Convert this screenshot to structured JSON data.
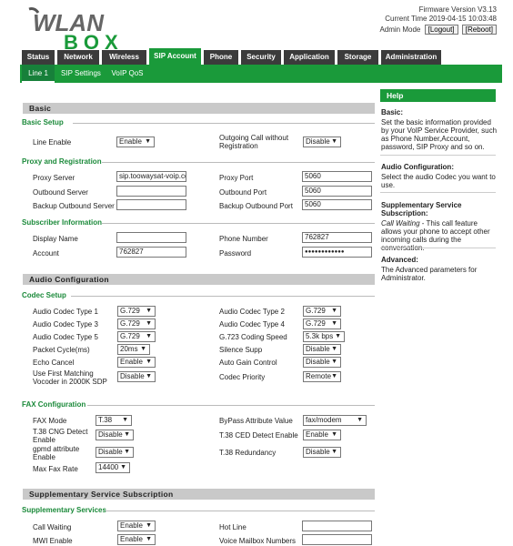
{
  "logo": {
    "line1": "WLAN",
    "line2": "BOX"
  },
  "firmware": {
    "version": "Firmware Version V3.13",
    "time": "Current Time 2019-04-15 10:03:48",
    "mode": "Admin Mode",
    "logout": "[Logout]",
    "reboot": "[Reboot]"
  },
  "nav": {
    "tabs": [
      "Status",
      "Network",
      "Wireless",
      "SIP Account",
      "Phone",
      "Security",
      "Application",
      "Storage",
      "Administration"
    ],
    "sub": [
      "Line 1",
      "SIP Settings",
      "VoIP QoS"
    ]
  },
  "basic": {
    "title": "Basic",
    "setup": {
      "title": "Basic Setup",
      "line_enable": {
        "label": "Line Enable",
        "value": "Enable"
      },
      "outgoing": {
        "label": "Outgoing Call without Registration",
        "value": "Disable"
      }
    },
    "proxy": {
      "title": "Proxy and Registration",
      "proxy_server": {
        "label": "Proxy Server",
        "value": "sip.toowaysat-voip.co"
      },
      "proxy_port": {
        "label": "Proxy Port",
        "value": "5060"
      },
      "outbound_server": {
        "label": "Outbound Server",
        "value": ""
      },
      "outbound_port": {
        "label": "Outbound Port",
        "value": "5060"
      },
      "backup_server": {
        "label": "Backup Outbound Server",
        "value": ""
      },
      "backup_port": {
        "label": "Backup Outbound Port",
        "value": "5060"
      }
    },
    "subscriber": {
      "title": "Subscriber Information",
      "display_name": {
        "label": "Display Name",
        "value": ""
      },
      "phone_number": {
        "label": "Phone Number",
        "value": "762827"
      },
      "account": {
        "label": "Account",
        "value": "762827"
      },
      "password": {
        "label": "Password",
        "value": "●●●●●●●●●●●●"
      }
    }
  },
  "audio": {
    "title": "Audio Configuration",
    "codec": {
      "title": "Codec Setup",
      "c1": {
        "label": "Audio Codec Type 1",
        "value": "G.729"
      },
      "c2": {
        "label": "Audio Codec Type 2",
        "value": "G.729"
      },
      "c3": {
        "label": "Audio Codec Type 3",
        "value": "G.729"
      },
      "c4": {
        "label": "Audio Codec Type 4",
        "value": "G.729"
      },
      "c5": {
        "label": "Audio Codec Type 5",
        "value": "G.729"
      },
      "g723": {
        "label": "G.723 Coding Speed",
        "value": "5.3k bps"
      },
      "packet": {
        "label": "Packet Cycle(ms)",
        "value": "20ms"
      },
      "silence": {
        "label": "Silence Supp",
        "value": "Disable"
      },
      "echo": {
        "label": "Echo Cancel",
        "value": "Enable"
      },
      "agc": {
        "label": "Auto Gain Control",
        "value": "Disable"
      },
      "first_vocoder": {
        "label": "Use First Matching Vocoder in 2000K SDP",
        "value": "Disable"
      },
      "priority": {
        "label": "Codec Priority",
        "value": "Remote"
      }
    },
    "fax": {
      "title": "FAX Configuration",
      "mode": {
        "label": "FAX Mode",
        "value": "T.38"
      },
      "bypass": {
        "label": "ByPass Attribute Value",
        "value": "fax/modem"
      },
      "cng": {
        "label": "T.38 CNG Detect Enable",
        "value": "Disable"
      },
      "ced": {
        "label": "T.38 CED Detect Enable",
        "value": "Enable"
      },
      "gpmd": {
        "label": "gpmd attribute Enable",
        "value": "Disable"
      },
      "redundancy": {
        "label": "T.38 Redundancy",
        "value": "Disable"
      },
      "maxrate": {
        "label": "Max Fax Rate",
        "value": "14400"
      }
    }
  },
  "supp": {
    "title": "Supplementary Service Subscription",
    "services": {
      "title": "Supplementary Services",
      "waiting": {
        "label": "Call Waiting",
        "value": "Enable"
      },
      "hotline": {
        "label": "Hot Line",
        "value": ""
      },
      "mwi": {
        "label": "MWI Enable",
        "value": "Enable"
      },
      "voicemail": {
        "label": "Voice Mailbox Numbers",
        "value": ""
      }
    }
  },
  "help": {
    "title": "Help",
    "basic_title": "Basic:",
    "basic_text": "Set the basic information provided by your VoIP Service Provider, such as Phone Number,Account, password, SIP Proxy and so on.",
    "audio_title": "Audio Configuration:",
    "audio_text": "Select the audio Codec you want to use.",
    "supp_title": "Supplementary Service Subscription:",
    "supp_italic": "Call Waiting",
    "supp_text": " - This call feature allows your phone to accept other incoming calls during the conversation.",
    "adv_title": "Advanced:",
    "adv_text": "The Advanced parameters for Administrator."
  }
}
